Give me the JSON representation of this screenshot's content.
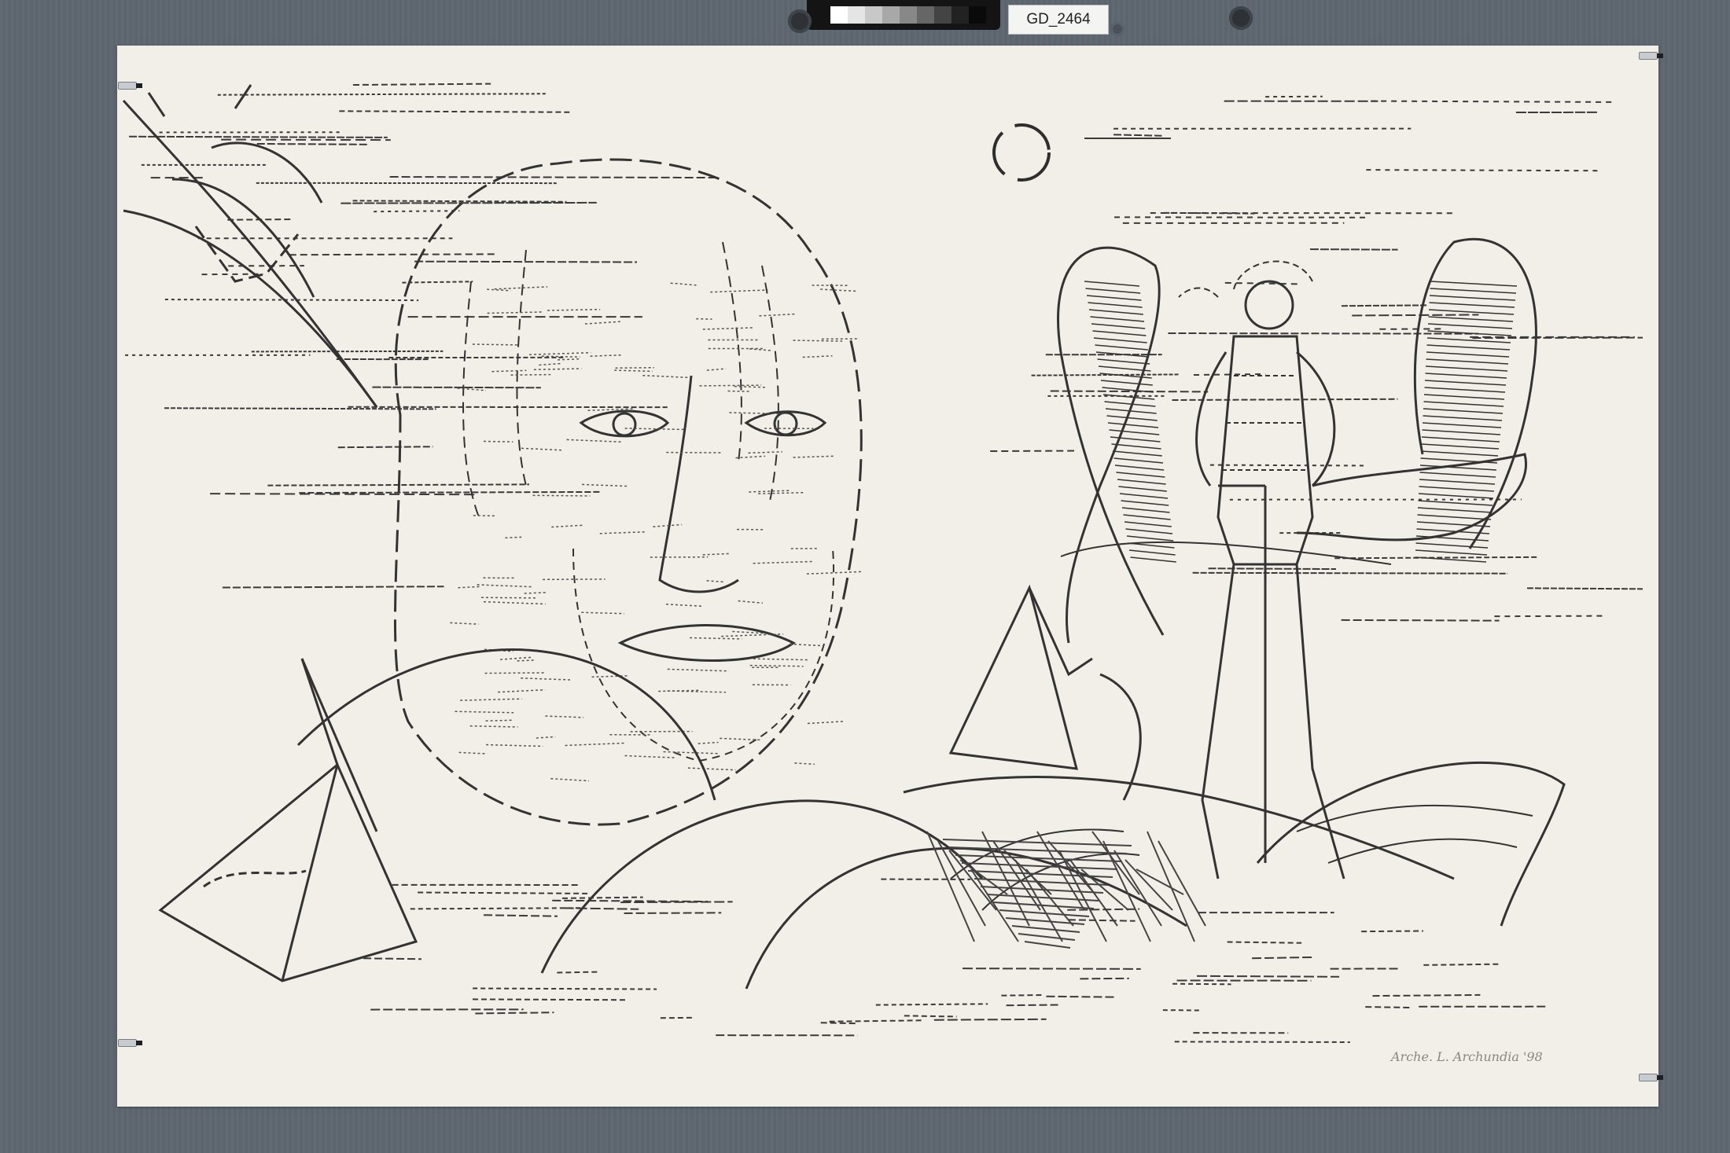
{
  "scene": {
    "label": "GD_2464",
    "subject": "woodcut print on cream paper mounted on grey board",
    "colors": {
      "board": "#5e6670",
      "paper": "#f2efe8",
      "ink": "#3a3a3a",
      "label_bg": "#f4f4f2",
      "color_chart_bg": "#141414"
    },
    "color_chart_swatches": [
      "#ffffff",
      "#e5e5e5",
      "#c8c8c8",
      "#a8a8a8",
      "#888888",
      "#666666",
      "#444444",
      "#222222",
      "#0a0a0a"
    ],
    "signature": "Arche. L. Archundia '98"
  }
}
